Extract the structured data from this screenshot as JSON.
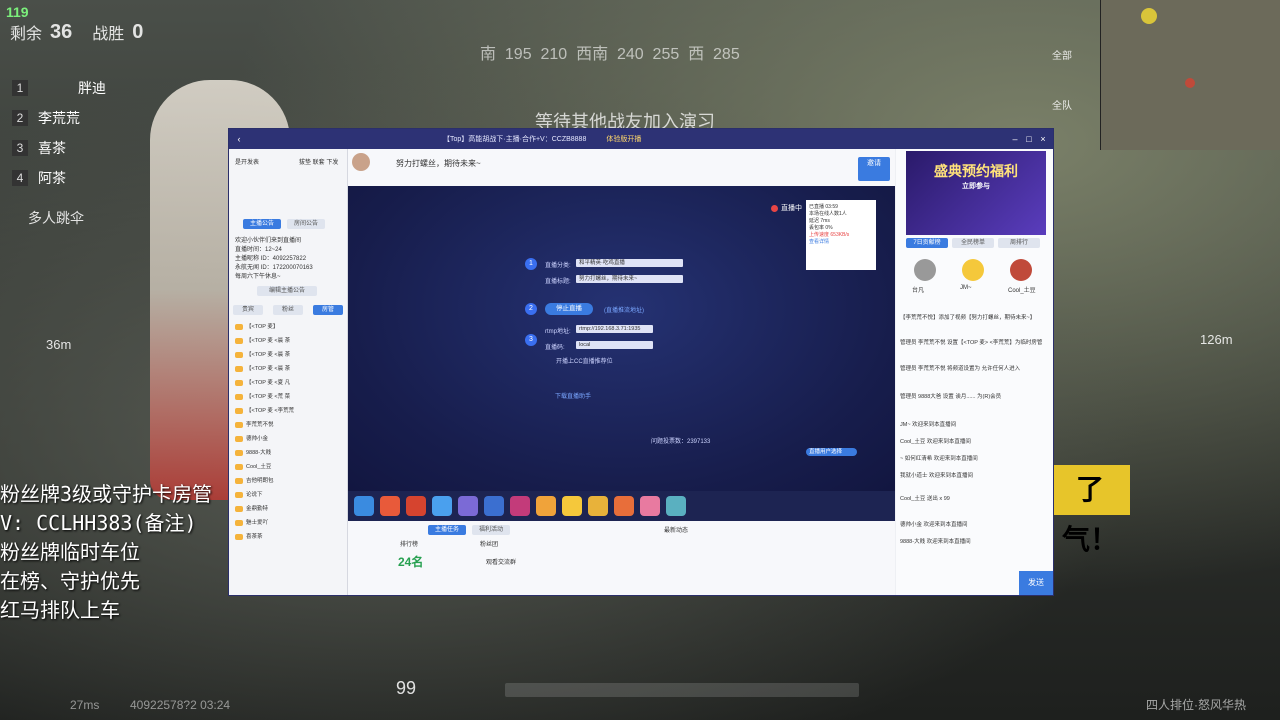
{
  "game": {
    "fps": "119",
    "remaining_label": "剩余",
    "remaining_value": "36",
    "kills_label": "战胜",
    "kills_value": "0",
    "compass": "南  195  210  西南  240  255  西  285",
    "waiting_text": "等待其他战友加入演习",
    "team": [
      {
        "num": "1",
        "name": "胖迪"
      },
      {
        "num": "2",
        "name": "李荒荒"
      },
      {
        "num": "3",
        "name": "喜茶"
      },
      {
        "num": "4",
        "name": "阿茶"
      }
    ],
    "multi_team": "多人跳伞",
    "distance_left": "36m",
    "distance_right": "126m",
    "fan_text": "粉丝牌3级或守护卡房管\nV: CCLHH383(备注)\n粉丝牌临时车位\n在榜、守护优先\n红马排队上车",
    "banner_text": "了气！",
    "ammo": "99",
    "ping": "27ms",
    "bottom_id": "40922578?2  03:24",
    "mode_text": "四人排位·怒风华热",
    "voice_all": "全部",
    "mic_all": "全队"
  },
  "app": {
    "title": "【Top】高能胡战下·主播·合作+V：CCZB8888",
    "title_sub": "体验版开播",
    "left": {
      "top_links": [
        "是开发表",
        "拔垫 联套 下发"
      ],
      "tabs": [
        "主播公告",
        "房间公告"
      ],
      "notice": [
        "欢迎小伙伴们来到直播间",
        "直播时间：12~24",
        "主播昵称 ID：4092257822",
        "永航无闻 ID：172200070163",
        "每周六下午休息~"
      ],
      "edit_btn": "编辑主播公告",
      "tabs2": [
        "贵宾",
        "粉丝",
        "房管"
      ],
      "chat": [
        "【<TOP 麦】",
        "【<TOP 麦  <晨 茶",
        "【<TOP 麦  <晨 茶",
        "【<TOP 麦  <晨 茶",
        "【<TOP 麦  <夏 凡",
        "【<TOP 麦  <荒 菜",
        "【<TOP 麦  <李荒荒",
        "李荒荒不悦",
        "德帅小金",
        "9888-大贱",
        "Cool_土豆",
        "吉他明朗包",
        "论说下",
        "金鼎勤特",
        "魅士爱吖",
        "喜茶茶"
      ]
    },
    "header": {
      "hello": "努力打螺丝，期待未来~",
      "invite": "邀请"
    },
    "stage": {
      "live_label": "直播中",
      "step1_label1": "直播分类:",
      "step1_val1": "和平精英·吃鸡直播",
      "step1_label2": "直播标题:",
      "step1_val2": "努力打螺丝，期待未来~",
      "stop_btn": "停止直播",
      "step2_hint": "(直播推流地址)",
      "step3_label1": "rtmp地址:",
      "step3_val1": "rtmp://192.168.3.71:1935",
      "step3_label2": "直播码:",
      "step3_val2": "local",
      "checkbox_text": "开播上CC直播推荐位",
      "download_link": "下载直播助手",
      "viewers": "问题投票数：2397133",
      "status": [
        "已直播 03:59",
        "本场在线人数1人",
        "延迟 7ms",
        "丢包率 0%",
        "上传速度 653KB/s",
        "查看详情"
      ],
      "bottom_btn": "直播用户选择"
    },
    "bottom": {
      "tabs": [
        "主播任务",
        "福利活动"
      ],
      "rank_label": "排行榜",
      "rank_value": "24名",
      "fans_label": "粉丝团",
      "fans_sub": "观看交流群",
      "recent_label": "最新动态"
    },
    "right": {
      "promo_title": "盛典预约福利",
      "promo_sub": "立即参与",
      "tabs": [
        "7日贡献榜",
        "全民榜单",
        "周排行"
      ],
      "top3": [
        "台凡",
        "JM~",
        "Cool_土豆"
      ],
      "messages": [
        "【李荒荒不悦】添加了视频【努力打螺丝，期待未来~】",
        "管理员 李荒荒不悦 设置【<TOP 麦> <李荒荒】为临时房管",
        "管理员 李荒荒不悦 将频道设置为 允许任何人进入",
        "管理员 9888大爸 设置 诶月...... 为(R)会员",
        "JM~ 欢迎来到本直播间",
        "Cool_土豆 欢迎来到本直播间",
        "~ 如何红清希 欢迎来到本直播间",
        "我就小道士 欢迎来到本直播间",
        "Cool_土豆 送出 x 99",
        "德帅小金 欢迎来到本直播间",
        "9888-大贱 欢迎来到本直播间"
      ],
      "send": "发送"
    }
  }
}
